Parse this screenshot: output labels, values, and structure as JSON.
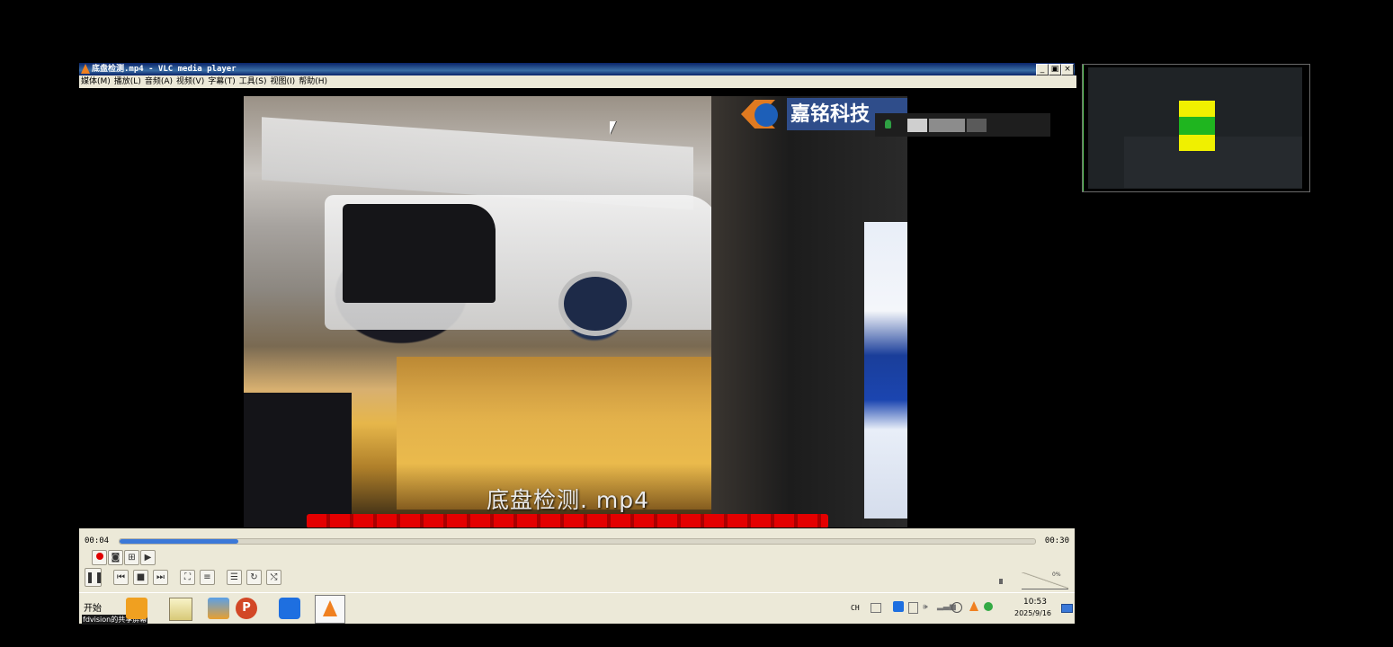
{
  "window": {
    "title": "底盘检测.mp4 - VLC media player",
    "minimize": "_",
    "restore": "&#9635;",
    "close": "×"
  },
  "menu": [
    "媒体(M)",
    "播放(L)",
    "音频(A)",
    "视频(V)",
    "字幕(T)",
    "工具(S)",
    "视图(I)",
    "帮助(H)"
  ],
  "video": {
    "logo_text": "嘉铭科技",
    "filename_overlay": "底盘检测. mp4"
  },
  "playback": {
    "elapsed": "00:04",
    "total": "00:30",
    "progress": 0.13
  },
  "volume": {
    "percent_label": "0%"
  },
  "taskbar": {
    "start_label": "开始",
    "share_label": "fdvision的共享屏幕",
    "ime": "CH",
    "time": "10:53",
    "date": "2025/9/16"
  },
  "colors": {
    "title_bar": "#0a246a",
    "seek_fill": "#3b78d8",
    "record": "#e00000",
    "window_face": "#ece9d8"
  }
}
